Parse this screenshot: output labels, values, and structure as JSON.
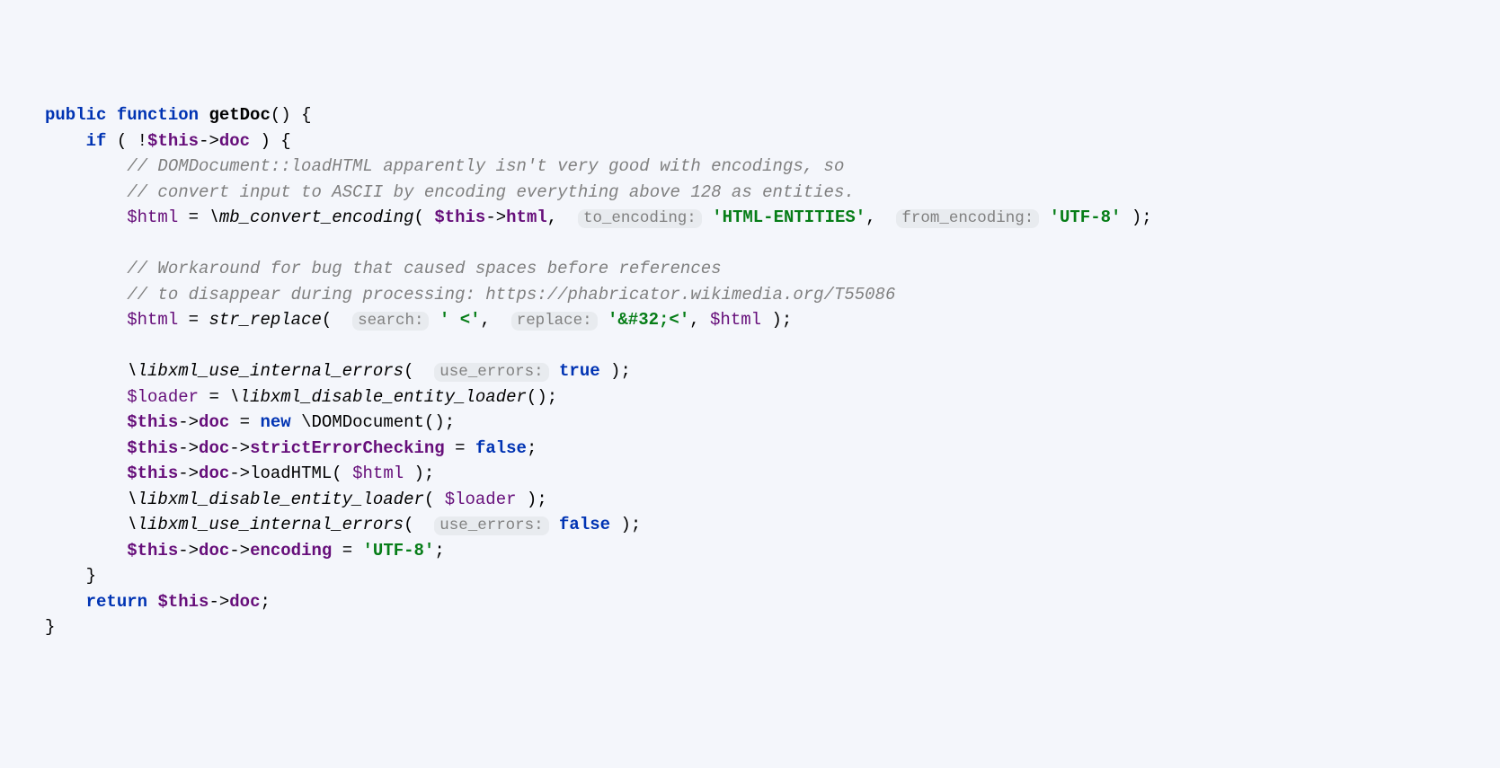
{
  "code": {
    "kw_public": "public",
    "kw_function": "function",
    "fn_name": "getDoc",
    "kw_if": "if",
    "this": "$this",
    "arrow": "->",
    "prop_doc": "doc",
    "comment1": "// DOMDocument::loadHTML apparently isn't very good with encodings, so",
    "comment2": "// convert input to ASCII by encoding everything above 128 as entities.",
    "var_html": "$html",
    "call_mbconv": "\\mb_convert_encoding",
    "prop_html": "html",
    "hint_toenc": "to_encoding:",
    "str_htmlent": "'HTML-ENTITIES'",
    "hint_fromenc": "from_encoding:",
    "str_utf8": "'UTF-8'",
    "comment3": "// Workaround for bug that caused spaces before references",
    "comment4": "// to disappear during processing: https://phabricator.wikimedia.org/T55086",
    "call_strrep": "str_replace",
    "hint_search": "search:",
    "str_spacelt": "' <'",
    "hint_replace": "replace:",
    "str_entitylt": "'&#32;<'",
    "call_libxmlerr": "\\libxml_use_internal_errors",
    "hint_useerr": "use_errors:",
    "true": "true",
    "false": "false",
    "var_loader": "$loader",
    "call_libxmldis": "\\libxml_disable_entity_loader",
    "kw_new": "new",
    "cls_domdoc": "\\DOMDocument",
    "prop_strict": "strictErrorChecking",
    "method_loadhtml": "loadHTML",
    "prop_encoding": "encoding",
    "kw_return": "return"
  }
}
